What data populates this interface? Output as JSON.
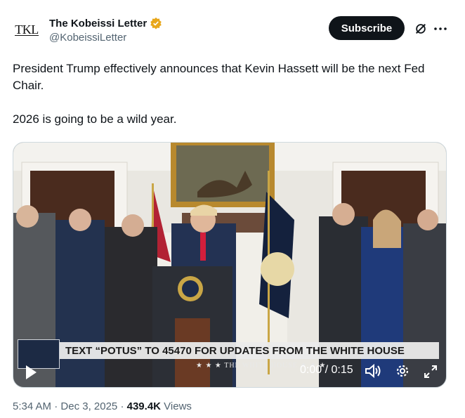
{
  "author": {
    "avatar_text": "TKL",
    "display_name": "The Kobeissi Letter",
    "handle": "@KobeissiLetter",
    "verified_color": "#e8a71a"
  },
  "actions": {
    "subscribe_label": "Subscribe",
    "grok_icon": "grok-icon",
    "more_icon": "more-icon"
  },
  "tweet": {
    "line1": "President Trump effectively announces that Kevin Hassett will be the next Fed Chair.",
    "line2": "2026 is going to be a wild year."
  },
  "video": {
    "banner_text": "TEXT “POTUS” TO 45470 FOR UPDATES FROM THE WHITE HOUSE",
    "banner_sub": "★ ★ ★  THE WHITE HOUSE  ★ ★ ★",
    "time": "0:00 / 0:15"
  },
  "meta": {
    "time": "5:34 AM",
    "separator1": " · ",
    "date": "Dec 3, 2025",
    "separator2": " · ",
    "views_count": "439.4K",
    "views_label": " Views"
  }
}
